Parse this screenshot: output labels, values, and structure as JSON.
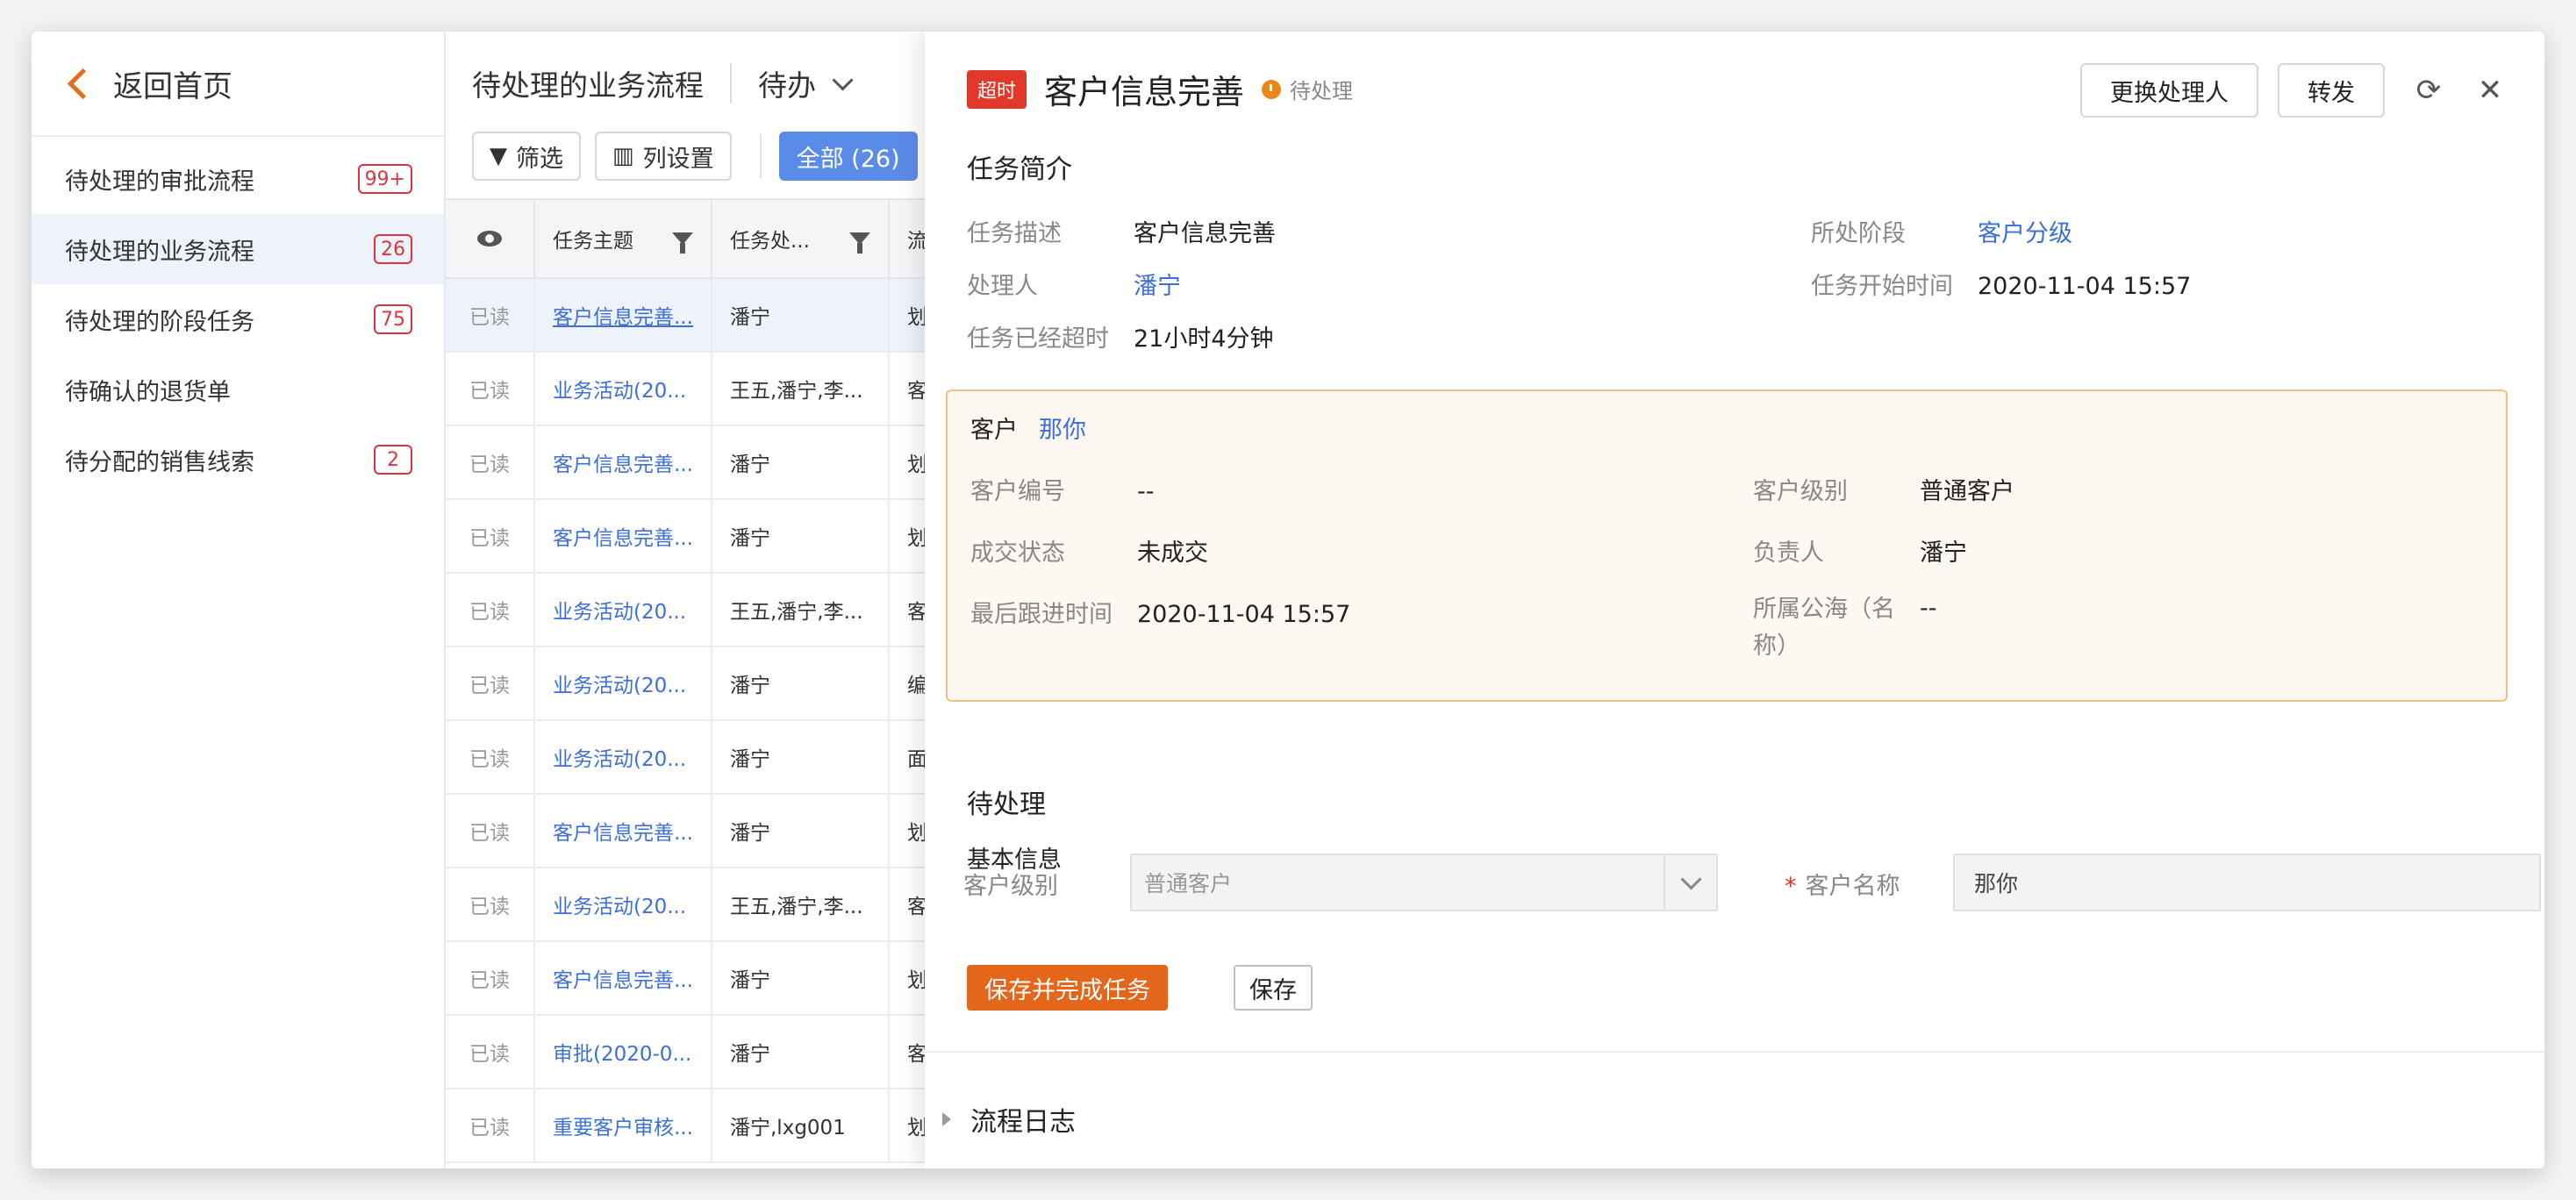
{
  "sidebar": {
    "back_label": "返回首页",
    "items": [
      {
        "label": "待处理的审批流程",
        "badge": "99+"
      },
      {
        "label": "待处理的业务流程",
        "badge": "26"
      },
      {
        "label": "待处理的阶段任务",
        "badge": "75"
      },
      {
        "label": "待确认的退货单",
        "badge": ""
      },
      {
        "label": "待分配的销售线索",
        "badge": "2"
      }
    ]
  },
  "list": {
    "title": "待处理的业务流程",
    "filter_label": "待办",
    "toolbar": {
      "filter": "筛选",
      "columns": "列设置",
      "all": "全部 (26)"
    },
    "columns": [
      "任务主题",
      "任务处...",
      "流"
    ],
    "rows": [
      {
        "read": "已读",
        "subject": "客户信息完善...",
        "handler": "潘宁",
        "flow": "划"
      },
      {
        "read": "已读",
        "subject": "业务活动(20...",
        "handler": "王五,潘宁,李...",
        "flow": "客"
      },
      {
        "read": "已读",
        "subject": "客户信息完善...",
        "handler": "潘宁",
        "flow": "划"
      },
      {
        "read": "已读",
        "subject": "客户信息完善...",
        "handler": "潘宁",
        "flow": "划"
      },
      {
        "read": "已读",
        "subject": "业务活动(20...",
        "handler": "王五,潘宁,李...",
        "flow": "客"
      },
      {
        "read": "已读",
        "subject": "业务活动(20...",
        "handler": "潘宁",
        "flow": "编"
      },
      {
        "read": "已读",
        "subject": "业务活动(20...",
        "handler": "潘宁",
        "flow": "面"
      },
      {
        "read": "已读",
        "subject": "客户信息完善...",
        "handler": "潘宁",
        "flow": "划"
      },
      {
        "read": "已读",
        "subject": "业务活动(20...",
        "handler": "王五,潘宁,李...",
        "flow": "客"
      },
      {
        "read": "已读",
        "subject": "客户信息完善...",
        "handler": "潘宁",
        "flow": "划"
      },
      {
        "read": "已读",
        "subject": "审批(2020-0...",
        "handler": "潘宁",
        "flow": "客"
      },
      {
        "read": "已读",
        "subject": "重要客户审核...",
        "handler": "潘宁,lxg001",
        "flow": "划"
      }
    ]
  },
  "detail": {
    "tag": "超时",
    "title": "客户信息完善",
    "status": "待处理",
    "actions": {
      "change_handler": "更换处理人",
      "forward": "转发"
    },
    "summary_title": "任务简介",
    "summary": {
      "desc_label": "任务描述",
      "desc": "客户信息完善",
      "stage_label": "所处阶段",
      "stage": "客户分级",
      "handler_label": "处理人",
      "handler": "潘宁",
      "start_label": "任务开始时间",
      "start": "2020-11-04 15:57",
      "overdue_label": "任务已经超时",
      "overdue": "21小时4分钟"
    },
    "customer": {
      "label": "客户",
      "name": "那你",
      "code_label": "客户编号",
      "code": "--",
      "level_label": "客户级别",
      "level": "普通客户",
      "deal_label": "成交状态",
      "deal": "未成交",
      "owner_label": "负责人",
      "owner": "潘宁",
      "followup_label": "最后跟进时间",
      "followup": "2020-11-04 15:57",
      "pool_label": "所属公海（名称）",
      "pool": "--"
    },
    "pending_title": "待处理",
    "basic_title": "基本信息",
    "form": {
      "level_label": "客户级别",
      "level_value": "普通客户",
      "name_label": "客户名称",
      "name_value": "那你",
      "required": "*"
    },
    "buttons": {
      "save_complete": "保存并完成任务",
      "save": "保存"
    },
    "log_title": "流程日志"
  }
}
